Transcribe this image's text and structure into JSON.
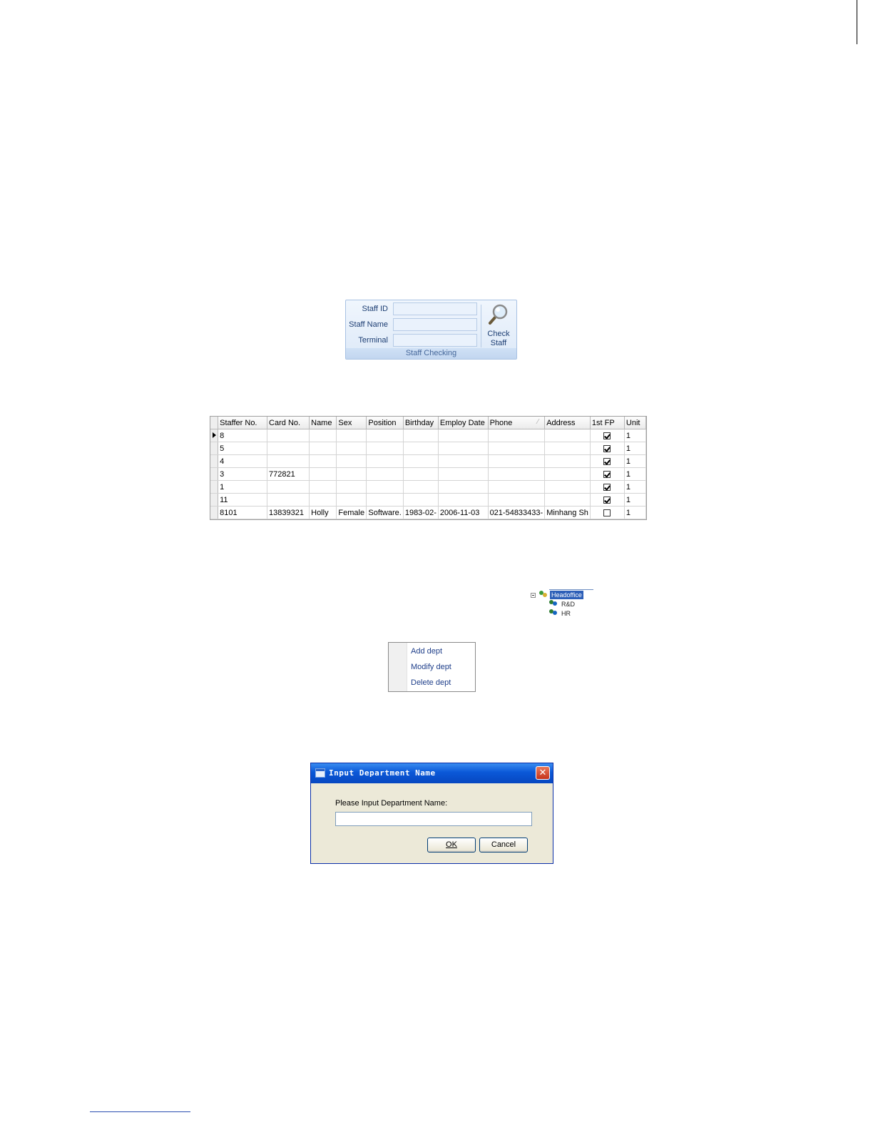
{
  "staff_checking": {
    "labels": {
      "staff_id": "Staff ID",
      "staff_name": "Staff Name",
      "terminal": "Terminal"
    },
    "fields": {
      "staff_id": "",
      "staff_name": "",
      "terminal": ""
    },
    "check_button": {
      "line1": "Check",
      "line2": "Staff"
    },
    "group_label": "Staff Checking"
  },
  "staff_grid": {
    "columns": [
      "Staffer No.",
      "Card No.",
      "Name",
      "Sex",
      "Position",
      "Birthday",
      "Employ Date",
      "Phone",
      "Address",
      "1st FP",
      "Unit"
    ],
    "rows": [
      {
        "no": "8",
        "card": "",
        "name": "",
        "sex": "",
        "position": "",
        "birthday": "",
        "employ": "",
        "phone": "",
        "address": "",
        "fp": true,
        "unit": "1"
      },
      {
        "no": "5",
        "card": "",
        "name": "",
        "sex": "",
        "position": "",
        "birthday": "",
        "employ": "",
        "phone": "",
        "address": "",
        "fp": true,
        "unit": "1"
      },
      {
        "no": "4",
        "card": "",
        "name": "",
        "sex": "",
        "position": "",
        "birthday": "",
        "employ": "",
        "phone": "",
        "address": "",
        "fp": true,
        "unit": "1"
      },
      {
        "no": "3",
        "card": "772821",
        "name": "",
        "sex": "",
        "position": "",
        "birthday": "",
        "employ": "",
        "phone": "",
        "address": "",
        "fp": true,
        "unit": "1"
      },
      {
        "no": "1",
        "card": "",
        "name": "",
        "sex": "",
        "position": "",
        "birthday": "",
        "employ": "",
        "phone": "",
        "address": "",
        "fp": true,
        "unit": "1"
      },
      {
        "no": "11",
        "card": "",
        "name": "",
        "sex": "",
        "position": "",
        "birthday": "",
        "employ": "",
        "phone": "",
        "address": "",
        "fp": true,
        "unit": "1"
      },
      {
        "no": "8101",
        "card": "13839321",
        "name": "Holly",
        "sex": "Female",
        "position": "Software.",
        "birthday": "1983-02-",
        "employ": "2006-11-03",
        "phone": "021-54833433-",
        "address": "Minhang Sh",
        "fp": false,
        "unit": "1"
      }
    ]
  },
  "dept_tree": {
    "root": "Headoffice",
    "children": [
      "R&D",
      "HR"
    ]
  },
  "context_menu": {
    "items": [
      "Add dept",
      "Modify dept",
      "Delete dept"
    ]
  },
  "dialog": {
    "title": "Input Department Name",
    "prompt": "Please Input Department Name:",
    "input_value": "",
    "ok_label": "OK",
    "cancel_label": "Cancel"
  }
}
